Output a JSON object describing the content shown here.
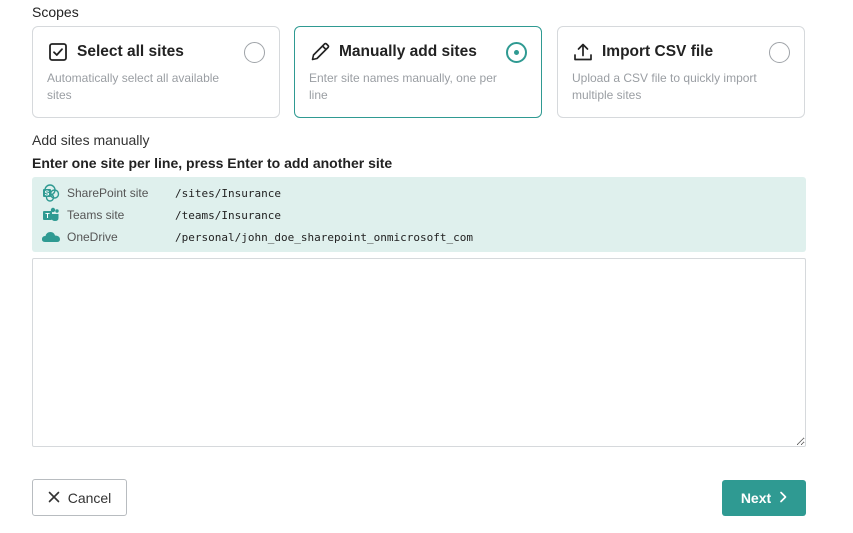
{
  "scopes": {
    "label": "Scopes",
    "options": [
      {
        "title": "Select all sites",
        "description": "Automatically select all available sites",
        "icon": "checkbox-icon",
        "selected": false
      },
      {
        "title": "Manually add sites",
        "description": "Enter site names manually, one per line",
        "icon": "pencil-icon",
        "selected": true
      },
      {
        "title": "Import CSV file",
        "description": "Upload a CSV file to quickly import multiple sites",
        "icon": "upload-icon",
        "selected": false
      }
    ]
  },
  "manual": {
    "label": "Add sites manually",
    "instruction": "Enter one site per line, press Enter to add another site",
    "examples": [
      {
        "type": "SharePoint site",
        "path": "/sites/Insurance",
        "icon": "sharepoint-icon"
      },
      {
        "type": "Teams site",
        "path": "/teams/Insurance",
        "icon": "teams-icon"
      },
      {
        "type": "OneDrive",
        "path": "/personal/john_doe_sharepoint_onmicrosoft_com",
        "icon": "onedrive-icon"
      }
    ],
    "input_value": ""
  },
  "footer": {
    "cancel_label": "Cancel",
    "next_label": "Next"
  },
  "colors": {
    "accent": "#2f9a92",
    "examples_bg": "#dff0ed",
    "border": "#d6d9dc",
    "muted_text": "#9a9ea3"
  }
}
